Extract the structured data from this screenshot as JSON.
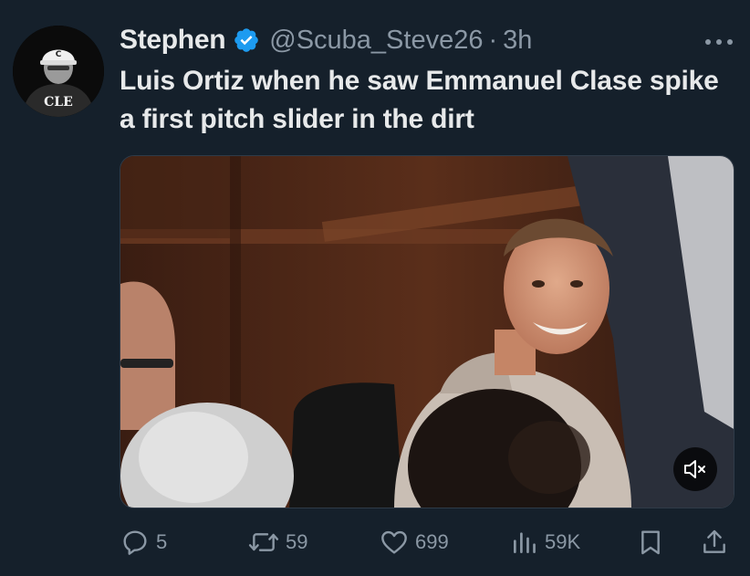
{
  "tweet": {
    "author_name": "Stephen",
    "handle": "@Scuba_Steve26",
    "separator": "·",
    "time": "3h",
    "text": "Luis Ortiz when he saw Emmanuel Clase spike a first pitch slider in the dirt",
    "avatar_text": "CLE",
    "avatar_cap_letter": "C"
  },
  "actions": {
    "replies": "5",
    "retweets": "59",
    "likes": "699",
    "views": "59K"
  },
  "icons": {
    "verified": "verified-badge-icon",
    "more": "more-horizontal-icon",
    "mute": "speaker-muted-icon",
    "reply": "reply-icon",
    "retweet": "retweet-icon",
    "like": "heart-icon",
    "views": "bar-chart-icon",
    "bookmark": "bookmark-icon",
    "share": "share-icon"
  },
  "colors": {
    "background": "#15202b",
    "text_primary": "#e7e9ea",
    "text_secondary": "#8b98a5",
    "verified_blue": "#1d9bf0"
  }
}
